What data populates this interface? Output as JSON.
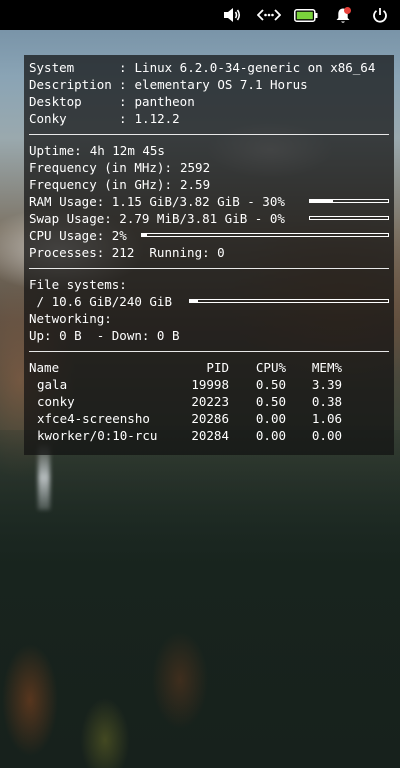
{
  "panel": {
    "icons": [
      "volume-icon",
      "network-icon",
      "battery-icon",
      "notifications-icon",
      "power-icon"
    ],
    "battery_color": "#7ad23c",
    "notification_dot_color": "#e8413b"
  },
  "conky": {
    "system": {
      "system_label": "System",
      "system_value": "Linux 6.2.0-34-generic on x86_64",
      "description_label": "Description",
      "description_value": "elementary OS 7.1 Horus",
      "desktop_label": "Desktop",
      "desktop_value": "pantheon",
      "conky_label": "Conky",
      "conky_value": "1.12.2",
      "separator": ":"
    },
    "status": {
      "uptime_label": "Uptime:",
      "uptime_value": "4h 12m 45s",
      "freq_mhz_label": "Frequency (in MHz):",
      "freq_mhz_value": "2592",
      "freq_ghz_label": "Frequency (in GHz):",
      "freq_ghz_value": "2.59",
      "ram_text": "RAM Usage: 1.15 GiB/3.82 GiB - 30%",
      "ram_percent": 30,
      "swap_text": "Swap Usage: 2.79 MiB/3.81 GiB - 0%",
      "swap_percent": 0,
      "cpu_text": "CPU Usage: 2%",
      "cpu_percent": 2,
      "processes_text": "Processes: 212  Running: 0"
    },
    "filesystems": {
      "label": "File systems:",
      "root_text": " / 10.6 GiB/240 GiB",
      "root_percent": 4,
      "networking_label": "Networking:",
      "network_text": "Up: 0 B  - Down: 0 B"
    },
    "processes": {
      "headers": [
        "Name",
        "PID",
        "CPU%",
        "MEM%"
      ],
      "rows": [
        {
          "name": "gala",
          "pid": "19998",
          "cpu": "0.50",
          "mem": "3.39"
        },
        {
          "name": "conky",
          "pid": "20223",
          "cpu": "0.50",
          "mem": "0.38"
        },
        {
          "name": "xfce4-screensho",
          "pid": "20286",
          "cpu": "0.00",
          "mem": "1.06"
        },
        {
          "name": "kworker/0:10-rcu",
          "pid": "20284",
          "cpu": "0.00",
          "mem": "0.00"
        }
      ]
    }
  }
}
